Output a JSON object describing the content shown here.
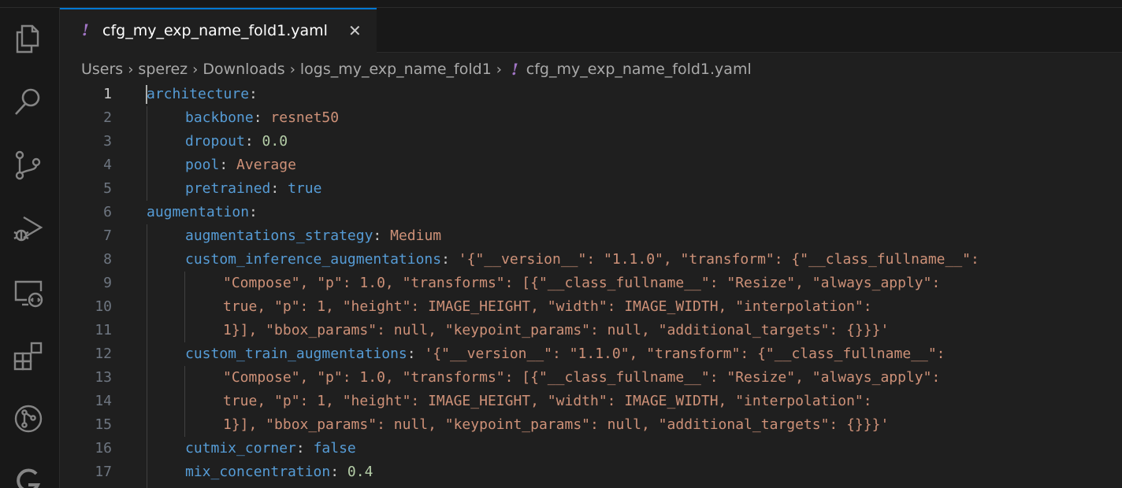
{
  "activity_bar": {
    "icons": [
      "explorer-icon",
      "search-icon",
      "source-control-icon",
      "run-debug-icon",
      "remote-explorer-icon",
      "extensions-icon",
      "github-icon",
      "extension-logo-icon"
    ]
  },
  "tab": {
    "file_name": "cfg_my_exp_name_fold1.yaml",
    "file_icon": "!",
    "close": "✕"
  },
  "breadcrumb": {
    "parts": [
      "Users",
      "sperez",
      "Downloads",
      "logs_my_exp_name_fold1"
    ],
    "file_icon": "!",
    "file": "cfg_my_exp_name_fold1.yaml"
  },
  "editor": {
    "line_numbers": [
      "1",
      "2",
      "3",
      "4",
      "5",
      "6",
      "7",
      "8",
      "9",
      "10",
      "11",
      "12",
      "13",
      "14",
      "15",
      "16",
      "17"
    ],
    "lines": {
      "l1": {
        "key": "architecture",
        "colon": ":"
      },
      "l2": {
        "key": "backbone",
        "colon": ": ",
        "value": "resnet50"
      },
      "l3": {
        "key": "dropout",
        "colon": ": ",
        "value": "0.0"
      },
      "l4": {
        "key": "pool",
        "colon": ": ",
        "value": "Average"
      },
      "l5": {
        "key": "pretrained",
        "colon": ": ",
        "value": "true"
      },
      "l6": {
        "key": "augmentation",
        "colon": ":"
      },
      "l7": {
        "key": "augmentations_strategy",
        "colon": ": ",
        "value": "Medium"
      },
      "l8": {
        "key": "custom_inference_augmentations",
        "colon": ": ",
        "value": "'{\"__version__\": \"1.1.0\", \"transform\": {\"__class_fullname__\":"
      },
      "l9": {
        "text": "\"Compose\", \"p\": 1.0, \"transforms\": [{\"__class_fullname__\": \"Resize\", \"always_apply\":"
      },
      "l10": {
        "text": "true, \"p\": 1, \"height\": IMAGE_HEIGHT, \"width\": IMAGE_WIDTH, \"interpolation\":"
      },
      "l11": {
        "text": "1}], \"bbox_params\": null, \"keypoint_params\": null, \"additional_targets\": {}}}'"
      },
      "l12": {
        "key": "custom_train_augmentations",
        "colon": ": ",
        "value": "'{\"__version__\": \"1.1.0\", \"transform\": {\"__class_fullname__\":"
      },
      "l13": {
        "text": "\"Compose\", \"p\": 1.0, \"transforms\": [{\"__class_fullname__\": \"Resize\", \"always_apply\":"
      },
      "l14": {
        "text": "true, \"p\": 1, \"height\": IMAGE_HEIGHT, \"width\": IMAGE_WIDTH, \"interpolation\":"
      },
      "l15": {
        "text": "1}], \"bbox_params\": null, \"keypoint_params\": null, \"additional_targets\": {}}}'"
      },
      "l16": {
        "key": "cutmix_corner",
        "colon": ": ",
        "value": "false"
      },
      "l17": {
        "key": "mix_concentration",
        "colon": ": ",
        "value": "0.4"
      }
    }
  },
  "colors": {
    "key": "#569cd6",
    "string": "#ce9178",
    "number": "#b5cea8",
    "boolean": "#569cd6",
    "accent": "#0078d4",
    "yaml_icon": "#a074c4"
  }
}
